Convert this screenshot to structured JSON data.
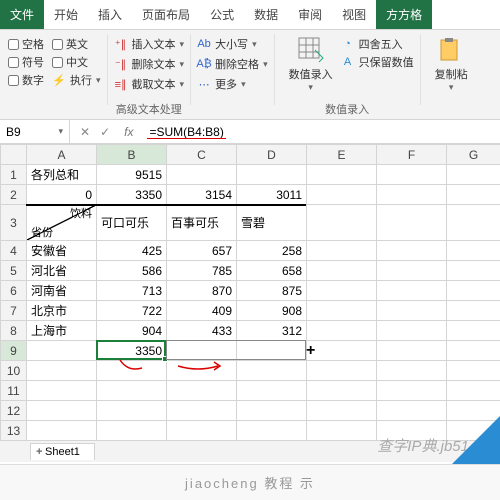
{
  "tabs": {
    "file": "文件",
    "t1": "开始",
    "t2": "插入",
    "t3": "页面布局",
    "t4": "公式",
    "t5": "数据",
    "t6": "审阅",
    "t7": "视图",
    "t8": "方方格"
  },
  "ribbon": {
    "view": {
      "c1": "空格",
      "c2": "英文",
      "c3": "符号",
      "c4": "中文",
      "c5": "数字",
      "c6": "执行"
    },
    "txt": {
      "b1": "插入文本",
      "b2": "删除文本",
      "b3": "截取文本",
      "group": "高级文本处理"
    },
    "case": {
      "b1": "大小写",
      "b2": "删除空格",
      "b3": "更多"
    },
    "entry": {
      "btn": "数值录入",
      "b1": "四舍五入",
      "b2": "只保留数值",
      "group": "数值录入"
    },
    "copy": {
      "btn": "复制粘"
    }
  },
  "fbar": {
    "name": "B9",
    "formula": "=SUM(B4:B8)",
    "fx": "fx"
  },
  "cols": [
    "",
    "A",
    "B",
    "C",
    "D",
    "E",
    "F",
    "G"
  ],
  "rows": {
    "r1": {
      "a": "各列总和",
      "b": "9515"
    },
    "r2": {
      "a": "0",
      "b": "3350",
      "c": "3154",
      "d": "3011"
    },
    "r3": {
      "tl": "饮料",
      "br": "省份",
      "b": "可口可乐",
      "c": "百事可乐",
      "d": "雪碧"
    },
    "r4": {
      "a": "安徽省",
      "b": "425",
      "c": "657",
      "d": "258"
    },
    "r5": {
      "a": "河北省",
      "b": "586",
      "c": "785",
      "d": "658"
    },
    "r6": {
      "a": "河南省",
      "b": "713",
      "c": "870",
      "d": "875"
    },
    "r7": {
      "a": "北京市",
      "b": "722",
      "c": "409",
      "d": "908"
    },
    "r8": {
      "a": "上海市",
      "b": "904",
      "c": "433",
      "d": "312"
    },
    "r9": {
      "b": "3350"
    }
  },
  "sheet": {
    "name": "Sheet1",
    "add": "+"
  },
  "watermark": "查字IP典.jb51.net",
  "footer": "jiaocheng 教程 示",
  "chart_data": {
    "type": "table",
    "title": "各列总和",
    "row_labels": [
      "安徽省",
      "河北省",
      "河南省",
      "北京市",
      "上海市"
    ],
    "col_labels": [
      "可口可乐",
      "百事可乐",
      "雪碧"
    ],
    "data": [
      [
        425,
        657,
        258
      ],
      [
        586,
        785,
        658
      ],
      [
        713,
        870,
        875
      ],
      [
        722,
        409,
        908
      ],
      [
        904,
        433,
        312
      ]
    ],
    "col_sums": [
      3350,
      3154,
      3011
    ],
    "grand_total": 9515
  }
}
